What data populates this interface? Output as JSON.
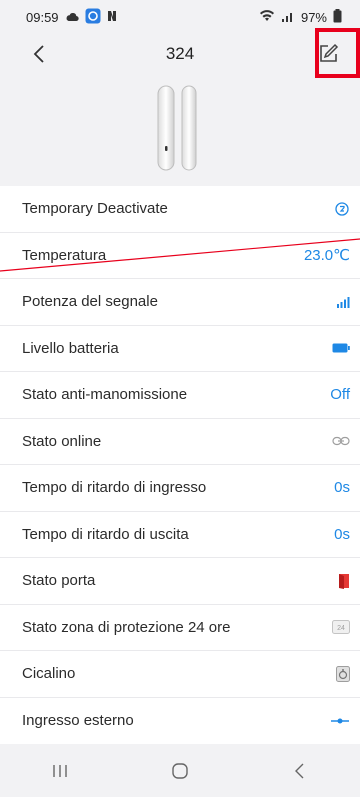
{
  "status_bar": {
    "time": "09:59",
    "battery": "97%"
  },
  "header": {
    "title": "324"
  },
  "rows": [
    {
      "label": "Temporary Deactivate",
      "value": "",
      "icon": "timer-off-icon"
    },
    {
      "label": "Temperatura",
      "value": "23.0℃",
      "icon": ""
    },
    {
      "label": "Potenza del segnale",
      "value": "",
      "icon": "signal-bars-icon"
    },
    {
      "label": "Livello batteria",
      "value": "",
      "icon": "battery-icon"
    },
    {
      "label": "Stato anti-manomissione",
      "value": "Off",
      "icon": ""
    },
    {
      "label": "Stato online",
      "value": "",
      "icon": "link-icon"
    },
    {
      "label": "Tempo di ritardo di ingresso",
      "value": "0s",
      "icon": ""
    },
    {
      "label": "Tempo di ritardo di uscita",
      "value": "0s",
      "icon": ""
    },
    {
      "label": "Stato porta",
      "value": "",
      "icon": "door-open-icon"
    },
    {
      "label": "Stato zona di protezione 24 ore",
      "value": "",
      "icon": "24h-icon",
      "icon_text": "24"
    },
    {
      "label": "Cicalino",
      "value": "",
      "icon": "buzzer-icon"
    },
    {
      "label": "Ingresso esterno",
      "value": "",
      "icon": "external-input-icon"
    }
  ],
  "colors": {
    "accent": "#1e88e5",
    "highlight": "#e8001c",
    "door": "#e53935"
  }
}
